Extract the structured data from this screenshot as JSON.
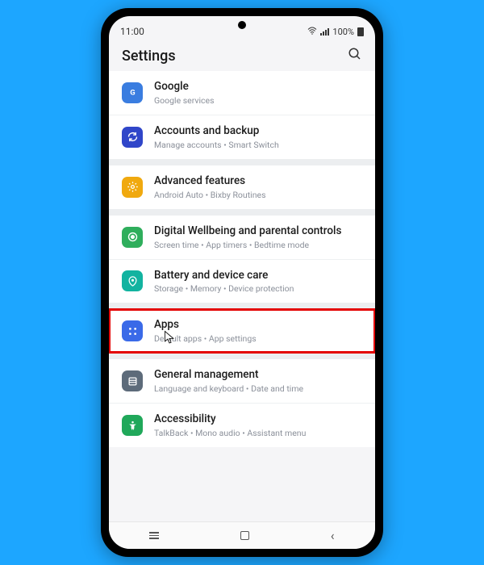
{
  "status": {
    "time": "11:00",
    "battery": "100%"
  },
  "header": {
    "title": "Settings"
  },
  "items": [
    {
      "title": "Google",
      "subtitle": "Google services",
      "color": "#3a7de0",
      "icon": "google"
    },
    {
      "title": "Accounts and backup",
      "subtitle": "Manage accounts  •  Smart Switch",
      "color": "#3046c9",
      "icon": "sync"
    },
    {
      "title": "Advanced features",
      "subtitle": "Android Auto  •  Bixby Routines",
      "color": "#f0a90f",
      "icon": "gear"
    },
    {
      "title": "Digital Wellbeing and parental controls",
      "subtitle": "Screen time  •  App timers  •  Bedtime mode",
      "color": "#2fae5c",
      "icon": "wellbeing"
    },
    {
      "title": "Battery and device care",
      "subtitle": "Storage  •  Memory  •  Device protection",
      "color": "#12b3a0",
      "icon": "care"
    },
    {
      "title": "Apps",
      "subtitle": "Default apps  •  App settings",
      "color": "#3a6ae8",
      "icon": "apps"
    },
    {
      "title": "General management",
      "subtitle": "Language and keyboard  •  Date and time",
      "color": "#5d6b7a",
      "icon": "general"
    },
    {
      "title": "Accessibility",
      "subtitle": "TalkBack  •  Mono audio  •  Assistant menu",
      "color": "#20a85a",
      "icon": "access"
    }
  ],
  "highlight_index": 5,
  "cursor_on_index": 5
}
